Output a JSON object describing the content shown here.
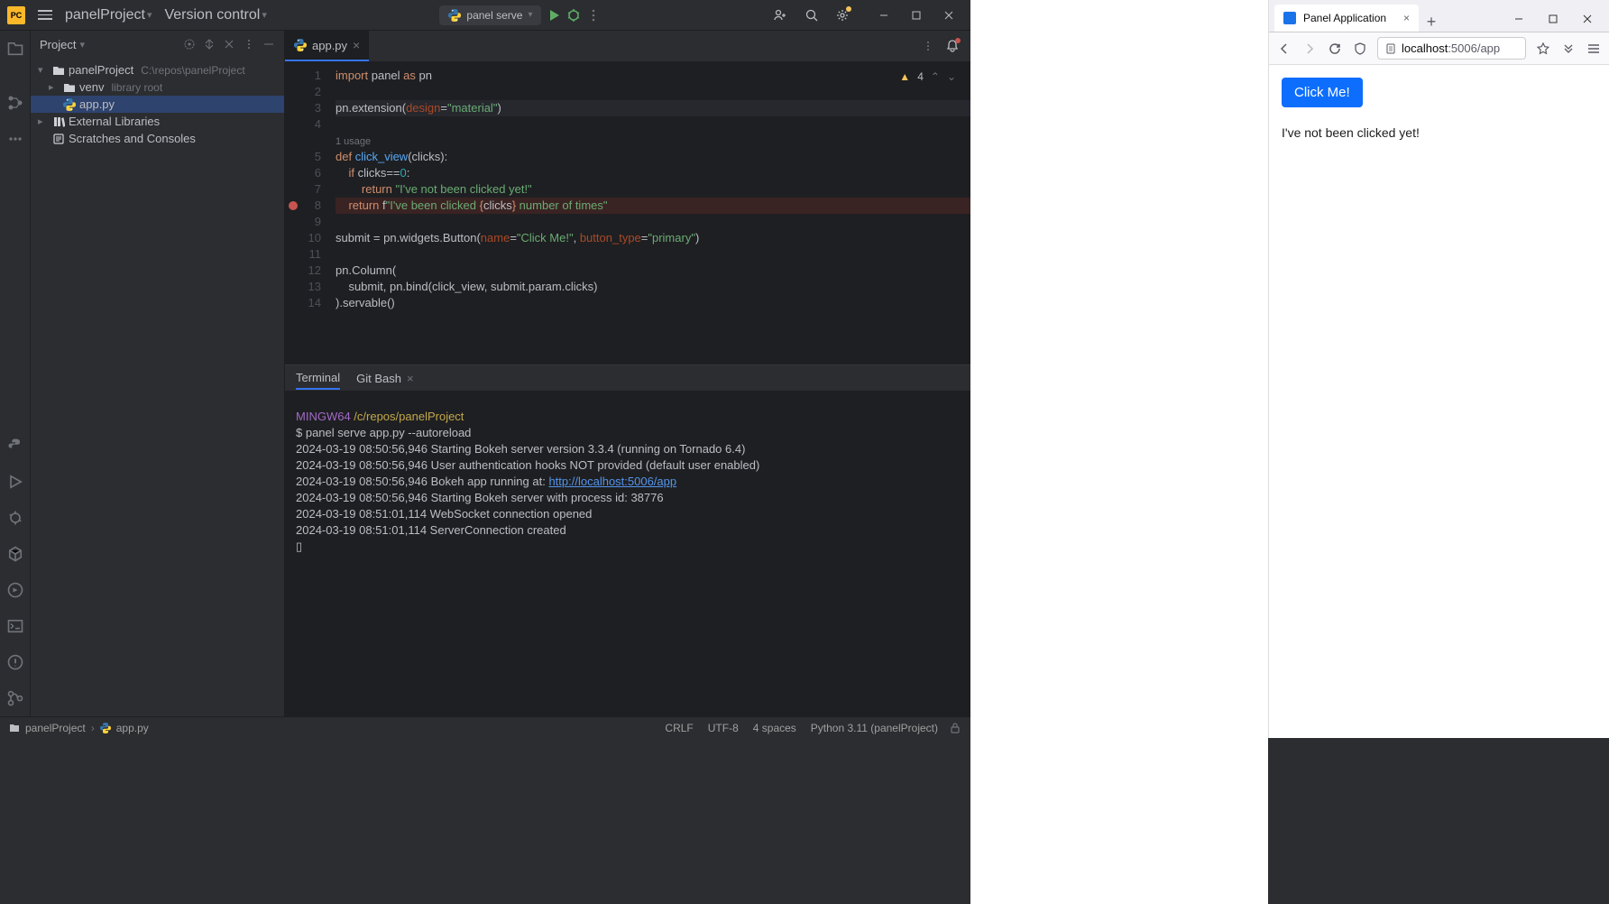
{
  "ide": {
    "logo": "PC",
    "project_name": "panelProject",
    "vcs_label": "Version control",
    "run_config": "panel serve",
    "titlebar_icons": {
      "run": "▶",
      "debug": "🐞"
    }
  },
  "project_panel": {
    "title": "Project",
    "items": [
      {
        "label": "panelProject",
        "hint": "C:\\repos\\panelProject",
        "icon": "folder",
        "chevron": "▾",
        "level": 0
      },
      {
        "label": "venv",
        "hint": "library root",
        "icon": "folder",
        "chevron": "▸",
        "level": 1
      },
      {
        "label": "app.py",
        "hint": "",
        "icon": "py",
        "chevron": "",
        "level": 1,
        "selected": true
      },
      {
        "label": "External Libraries",
        "hint": "",
        "icon": "lib",
        "chevron": "▸",
        "level": 0
      },
      {
        "label": "Scratches and Consoles",
        "hint": "",
        "icon": "scratch",
        "chevron": "",
        "level": 0
      }
    ]
  },
  "editor": {
    "tab_name": "app.py",
    "warnings": "4",
    "usage_label": "1 usage",
    "lines": [
      [
        {
          "c": "kw",
          "t": "import"
        },
        {
          "c": "nm",
          "t": " panel "
        },
        {
          "c": "kw",
          "t": "as"
        },
        {
          "c": "nm",
          "t": " pn"
        }
      ],
      [],
      [
        {
          "c": "nm",
          "t": "pn.extension("
        },
        {
          "c": "pa",
          "t": "design"
        },
        {
          "c": "nm",
          "t": "="
        },
        {
          "c": "st",
          "t": "\"material\""
        },
        {
          "c": "nm",
          "t": ")"
        }
      ],
      [],
      [
        {
          "c": "usage",
          "t": "1 usage"
        }
      ],
      [
        {
          "c": "kw",
          "t": "def "
        },
        {
          "c": "fn",
          "t": "click_view"
        },
        {
          "c": "nm",
          "t": "(clicks):"
        }
      ],
      [
        {
          "c": "nm",
          "t": "    "
        },
        {
          "c": "kw",
          "t": "if"
        },
        {
          "c": "nm",
          "t": " clicks=="
        },
        {
          "c": "nn",
          "t": "0"
        },
        {
          "c": "nm",
          "t": ":"
        }
      ],
      [
        {
          "c": "nm",
          "t": "        "
        },
        {
          "c": "kw",
          "t": "return "
        },
        {
          "c": "st",
          "t": "\"I've not been clicked yet!\""
        }
      ],
      [
        {
          "c": "nm",
          "t": "    "
        },
        {
          "c": "kw",
          "t": "return "
        },
        {
          "c": "nm",
          "t": "f"
        },
        {
          "c": "fst",
          "t": "\"I've been clicked "
        },
        {
          "c": "fexp",
          "t": "{"
        },
        {
          "c": "nm",
          "t": "clicks"
        },
        {
          "c": "fexp",
          "t": "}"
        },
        {
          "c": "fst",
          "t": " number of times\""
        }
      ],
      [],
      [
        {
          "c": "nm",
          "t": "submit = pn.widgets.Button("
        },
        {
          "c": "pa",
          "t": "name"
        },
        {
          "c": "nm",
          "t": "="
        },
        {
          "c": "st",
          "t": "\"Click Me!\""
        },
        {
          "c": "nm",
          "t": ", "
        },
        {
          "c": "pa",
          "t": "button_type"
        },
        {
          "c": "nm",
          "t": "="
        },
        {
          "c": "st",
          "t": "\"primary\""
        },
        {
          "c": "nm",
          "t": ")"
        }
      ],
      [],
      [
        {
          "c": "nm",
          "t": "pn.Column("
        }
      ],
      [
        {
          "c": "nm",
          "t": "    submit, pn.bind(click_view, submit.param.clicks)"
        }
      ],
      [
        {
          "c": "nm",
          "t": ").servable()"
        }
      ]
    ],
    "line_numbers": [
      "1",
      "2",
      "3",
      "4",
      "",
      "5",
      "6",
      "7",
      "8",
      "9",
      "10",
      "11",
      "12",
      "13",
      "14"
    ],
    "highlight_line": 2,
    "error_line": 8,
    "breakpoint_line": 8
  },
  "terminal": {
    "tabs": [
      {
        "label": "Terminal",
        "active": true
      },
      {
        "label": "Git Bash",
        "active": false,
        "closable": true
      }
    ],
    "prompt_user": "MINGW64",
    "prompt_path": "/c/repos/panelProject",
    "command": "$ panel serve app.py --autoreload",
    "log": [
      "2024-03-19 08:50:56,946 Starting Bokeh server version 3.3.4 (running on Tornado 6.4)",
      "2024-03-19 08:50:56,946 User authentication hooks NOT provided (default user enabled)",
      "2024-03-19 08:50:56,946 Bokeh app running at: ",
      "2024-03-19 08:50:56,946 Starting Bokeh server with process id: 38776",
      "2024-03-19 08:51:01,114 WebSocket connection opened",
      "2024-03-19 08:51:01,114 ServerConnection created"
    ],
    "url": "http://localhost:5006/app",
    "cursor": "▯"
  },
  "status_bar": {
    "breadcrumb": [
      "panelProject",
      "app.py"
    ],
    "right": [
      "CRLF",
      "UTF-8",
      "4 spaces",
      "Python 3.11 (panelProject)"
    ]
  },
  "browser": {
    "tab_title": "Panel Application",
    "url_host": "localhost",
    "url_rest": ":5006/app",
    "button_label": "Click Me!",
    "text": "I've not been clicked yet!"
  }
}
